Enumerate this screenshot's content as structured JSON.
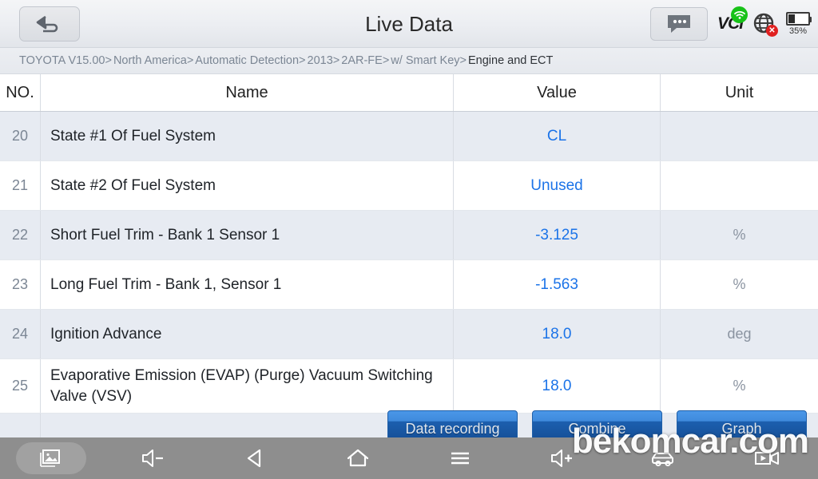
{
  "titlebar": {
    "title": "Live Data",
    "back_icon": "back-arrow-icon",
    "chat_icon": "chat-bubble-icon",
    "vci_label": "VCI",
    "wifi_icon": "wifi-icon",
    "globe_icon": "globe-disconnected-icon",
    "battery_percent": "35%",
    "battery_level": 35,
    "accent_blue": "#1b73e8",
    "wifi_green": "#18c219",
    "error_red": "#e02020"
  },
  "breadcrumb": {
    "items": [
      {
        "label": "TOYOTA V15.00",
        "sep": ">"
      },
      {
        "label": "North America",
        "sep": ">"
      },
      {
        "label": "Automatic Detection",
        "sep": ">"
      },
      {
        "label": "2013",
        "sep": ">"
      },
      {
        "label": "2AR-FE",
        "sep": ">"
      },
      {
        "label": "w/ Smart Key",
        "sep": ">"
      },
      {
        "label": "Engine and ECT",
        "sep": ""
      }
    ]
  },
  "table": {
    "headers": {
      "no": "NO.",
      "name": "Name",
      "value": "Value",
      "unit": "Unit"
    },
    "rows": [
      {
        "no": "20",
        "name": "State #1 Of Fuel System",
        "value": "CL",
        "unit": ""
      },
      {
        "no": "21",
        "name": "State #2 Of Fuel System",
        "value": "Unused",
        "unit": ""
      },
      {
        "no": "22",
        "name": "Short Fuel Trim - Bank 1 Sensor 1",
        "value": "-3.125",
        "unit": "%"
      },
      {
        "no": "23",
        "name": "Long Fuel Trim - Bank 1, Sensor 1",
        "value": "-1.563",
        "unit": "%"
      },
      {
        "no": "24",
        "name": "Ignition Advance",
        "value": "18.0",
        "unit": "deg"
      },
      {
        "no": "25",
        "name": "Evaporative Emission (EVAP) (Purge) Vacuum Switching Valve (VSV)",
        "value": "18.0",
        "unit": "%"
      }
    ]
  },
  "buttons": [
    {
      "label": "Data recording",
      "name": "data-recording-button"
    },
    {
      "label": "Combine",
      "name": "combine-button"
    },
    {
      "label": "Graph",
      "name": "graph-button"
    }
  ],
  "navbar": {
    "items": [
      {
        "icon": "screenshot-icon",
        "name": "nav-screenshot"
      },
      {
        "icon": "volume-down-icon",
        "name": "nav-volume-down"
      },
      {
        "icon": "back-triangle-icon",
        "name": "nav-back"
      },
      {
        "icon": "home-icon",
        "name": "nav-home"
      },
      {
        "icon": "menu-icon",
        "name": "nav-menu"
      },
      {
        "icon": "volume-up-icon",
        "name": "nav-volume-up"
      },
      {
        "icon": "car-icon",
        "name": "nav-car"
      },
      {
        "icon": "screen-record-icon",
        "name": "nav-screen-record"
      }
    ]
  },
  "watermark": {
    "text": "bekomcar.com"
  }
}
